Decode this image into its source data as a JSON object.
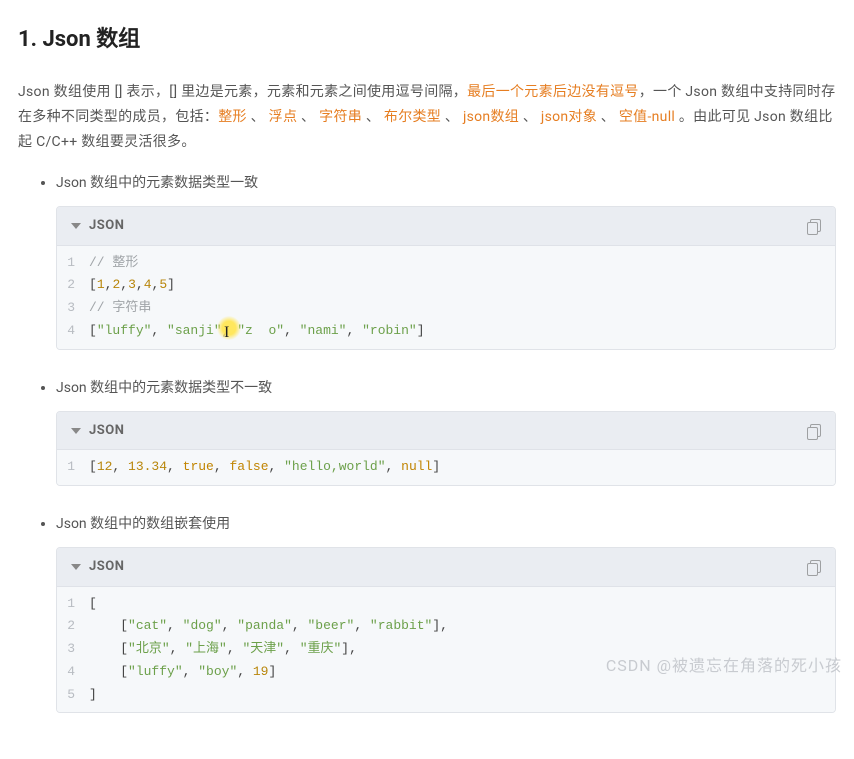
{
  "heading": "1. Json 数组",
  "para": {
    "p1a": "Json 数组使用 [] 表示，[] 里边是元素，元素和元素之间使用逗号间隔，",
    "p1b": "最后一个元素后边没有逗号",
    "p1c": "，一个 Json 数组中支持同时存在多种不同类型的成员，包括：",
    "types": [
      "整形",
      "浮点",
      "字符串",
      "布尔类型",
      "json数组",
      "json对象",
      "空值-null"
    ],
    "sep": " 、 ",
    "p1d": " 。由此可见 Json 数组比起 C/C++ 数组要灵活很多。"
  },
  "bullets": {
    "b1": "Json 数组中的元素数据类型一致",
    "b2": "Json 数组中的元素数据类型不一致",
    "b3": "Json 数组中的数组嵌套使用"
  },
  "codeLangLabel": "JSON",
  "code1": [
    {
      "n": "1",
      "seg": [
        {
          "c": "tok-comment",
          "t": "// 整形"
        }
      ]
    },
    {
      "n": "2",
      "seg": [
        {
          "c": "tok-bracket",
          "t": "["
        },
        {
          "c": "tok-number",
          "t": "1"
        },
        {
          "c": "tok-bracket",
          "t": ","
        },
        {
          "c": "tok-number",
          "t": "2"
        },
        {
          "c": "tok-bracket",
          "t": ","
        },
        {
          "c": "tok-number",
          "t": "3"
        },
        {
          "c": "tok-bracket",
          "t": ","
        },
        {
          "c": "tok-number",
          "t": "4"
        },
        {
          "c": "tok-bracket",
          "t": ","
        },
        {
          "c": "tok-number",
          "t": "5"
        },
        {
          "c": "tok-bracket",
          "t": "]"
        }
      ]
    },
    {
      "n": "3",
      "seg": [
        {
          "c": "tok-comment",
          "t": "// 字符串"
        }
      ]
    },
    {
      "n": "4",
      "seg": [
        {
          "c": "tok-bracket",
          "t": "["
        },
        {
          "c": "tok-string",
          "t": "\"luffy\""
        },
        {
          "c": "tok-bracket",
          "t": ", "
        },
        {
          "c": "tok-string",
          "t": "\"sanji\""
        },
        {
          "c": "tok-bracket",
          "t": ", "
        },
        {
          "c": "tok-string",
          "t": "\"z  o\""
        },
        {
          "c": "tok-bracket",
          "t": ", "
        },
        {
          "c": "tok-string",
          "t": "\"nami\""
        },
        {
          "c": "tok-bracket",
          "t": ", "
        },
        {
          "c": "tok-string",
          "t": "\"robin\""
        },
        {
          "c": "tok-bracket",
          "t": "]"
        }
      ],
      "cursorAt": 172
    }
  ],
  "code2": [
    {
      "n": "1",
      "seg": [
        {
          "c": "tok-bracket",
          "t": "["
        },
        {
          "c": "tok-number",
          "t": "12"
        },
        {
          "c": "tok-bracket",
          "t": ", "
        },
        {
          "c": "tok-number",
          "t": "13.34"
        },
        {
          "c": "tok-bracket",
          "t": ", "
        },
        {
          "c": "tok-keyword",
          "t": "true"
        },
        {
          "c": "tok-bracket",
          "t": ", "
        },
        {
          "c": "tok-keyword",
          "t": "false"
        },
        {
          "c": "tok-bracket",
          "t": ", "
        },
        {
          "c": "tok-string",
          "t": "\"hello,world\""
        },
        {
          "c": "tok-bracket",
          "t": ", "
        },
        {
          "c": "tok-null",
          "t": "null"
        },
        {
          "c": "tok-bracket",
          "t": "]"
        }
      ]
    }
  ],
  "code3": [
    {
      "n": "1",
      "seg": [
        {
          "c": "tok-bracket",
          "t": "["
        }
      ]
    },
    {
      "n": "2",
      "seg": [
        {
          "c": "",
          "t": "    "
        },
        {
          "c": "tok-bracket",
          "t": "["
        },
        {
          "c": "tok-string",
          "t": "\"cat\""
        },
        {
          "c": "tok-bracket",
          "t": ", "
        },
        {
          "c": "tok-string",
          "t": "\"dog\""
        },
        {
          "c": "tok-bracket",
          "t": ", "
        },
        {
          "c": "tok-string",
          "t": "\"panda\""
        },
        {
          "c": "tok-bracket",
          "t": ", "
        },
        {
          "c": "tok-string",
          "t": "\"beer\""
        },
        {
          "c": "tok-bracket",
          "t": ", "
        },
        {
          "c": "tok-string",
          "t": "\"rabbit\""
        },
        {
          "c": "tok-bracket",
          "t": "],"
        }
      ]
    },
    {
      "n": "3",
      "seg": [
        {
          "c": "",
          "t": "    "
        },
        {
          "c": "tok-bracket",
          "t": "["
        },
        {
          "c": "tok-string",
          "t": "\"北京\""
        },
        {
          "c": "tok-bracket",
          "t": ", "
        },
        {
          "c": "tok-string",
          "t": "\"上海\""
        },
        {
          "c": "tok-bracket",
          "t": ", "
        },
        {
          "c": "tok-string",
          "t": "\"天津\""
        },
        {
          "c": "tok-bracket",
          "t": ", "
        },
        {
          "c": "tok-string",
          "t": "\"重庆\""
        },
        {
          "c": "tok-bracket",
          "t": "],"
        }
      ]
    },
    {
      "n": "4",
      "seg": [
        {
          "c": "",
          "t": "    "
        },
        {
          "c": "tok-bracket",
          "t": "["
        },
        {
          "c": "tok-string",
          "t": "\"luffy\""
        },
        {
          "c": "tok-bracket",
          "t": ", "
        },
        {
          "c": "tok-string",
          "t": "\"boy\""
        },
        {
          "c": "tok-bracket",
          "t": ", "
        },
        {
          "c": "tok-number",
          "t": "19"
        },
        {
          "c": "tok-bracket",
          "t": "]"
        }
      ]
    },
    {
      "n": "5",
      "seg": [
        {
          "c": "tok-bracket",
          "t": "]"
        }
      ]
    }
  ],
  "watermark": "CSDN @被遗忘在角落的死小孩"
}
